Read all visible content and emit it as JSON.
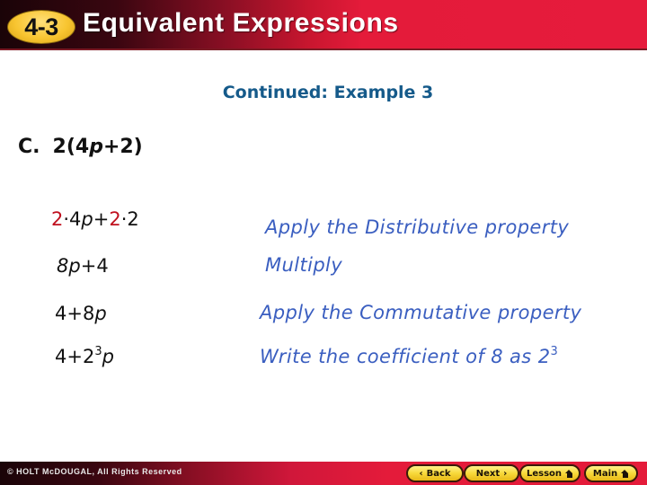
{
  "header": {
    "lesson_number": "4-3",
    "title": "Equivalent Expressions"
  },
  "subtitle": "Continued: Example 3",
  "problem": {
    "label": "C.",
    "expression_prefix": "2(4",
    "variable": "p",
    "expression_suffix": "+2)"
  },
  "steps": [
    {
      "expression_parts": [
        {
          "text": "2",
          "style": "red"
        },
        {
          "text": "·4",
          "style": "normal"
        },
        {
          "text": "p",
          "style": "italic"
        },
        {
          "text": "+",
          "style": "normal"
        },
        {
          "text": "2",
          "style": "red"
        },
        {
          "text": "·2",
          "style": "normal"
        }
      ],
      "note": "Apply the Distributive property"
    },
    {
      "expression_parts": [
        {
          "text": "8",
          "style": "italic"
        },
        {
          "text": "p",
          "style": "italic"
        },
        {
          "text": "+4",
          "style": "normal"
        }
      ],
      "note": "Multiply"
    },
    {
      "expression_parts": [
        {
          "text": "4+8",
          "style": "normal"
        },
        {
          "text": "p",
          "style": "italic"
        }
      ],
      "note": "Apply the Commutative property"
    },
    {
      "expression_parts": [
        {
          "text": "4+2",
          "style": "normal"
        },
        {
          "text": "3",
          "style": "sup"
        },
        {
          "text": "p",
          "style": "italic"
        }
      ],
      "note_text": "Write the coefficient of 8 as 2",
      "note_sup": "3"
    }
  ],
  "footer": {
    "copyright": "© HOLT McDOUGAL, All Rights Reserved",
    "buttons": {
      "back": {
        "label": "Back",
        "icon": "chevron-left-icon",
        "icon_glyph": "‹"
      },
      "next": {
        "label": "Next",
        "icon": "chevron-right-icon",
        "icon_glyph": "›"
      },
      "lesson": {
        "label": "Lesson",
        "icon": "home-icon"
      },
      "main": {
        "label": "Main",
        "icon": "home-icon"
      }
    }
  },
  "colors": {
    "header_red": "#e41b3a",
    "header_dark": "#1a0408",
    "badge_yellow": "#f8c531",
    "subtitle_blue": "#155a8a",
    "note_blue": "#3a5ec0",
    "highlight_red": "#c0101e"
  }
}
